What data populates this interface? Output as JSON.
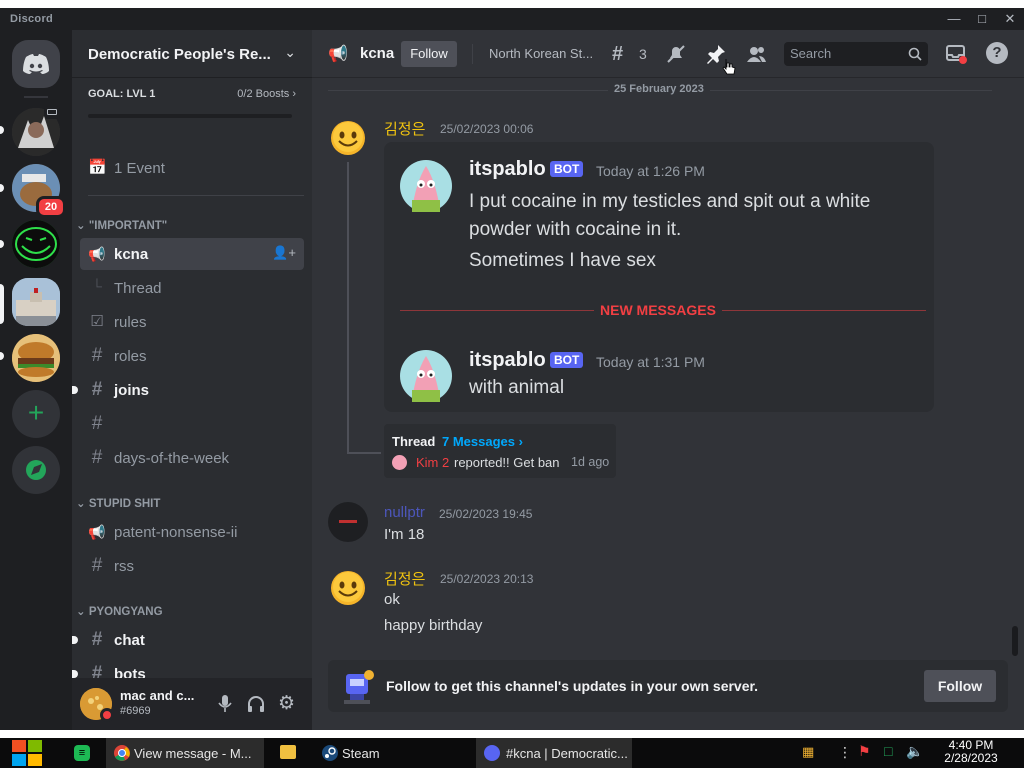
{
  "window": {
    "title": "Discord",
    "controls": [
      "minimize",
      "maximize",
      "close"
    ]
  },
  "servers": [
    {
      "name": "server-1",
      "color": "#3a3a3a",
      "unread": true,
      "badge": null
    },
    {
      "name": "server-2",
      "color": "#7a5a3a",
      "unread": true,
      "badge": "20"
    },
    {
      "name": "server-3",
      "color": "#1f8a2e",
      "unread": true,
      "badge": null
    },
    {
      "name": "server-4",
      "color": "#8aa0b8",
      "selected": true,
      "badge": null
    },
    {
      "name": "server-5",
      "color": "#c48a3c",
      "unread": true,
      "badge": null
    }
  ],
  "guild": {
    "name": "Democratic People's Re...",
    "goal_label": "GOAL: LVL 1",
    "boosts": "0/2 Boosts",
    "events": "1 Event"
  },
  "categories": [
    {
      "label": "\"IMPORTANT\""
    },
    {
      "label": "STUPID SHIT"
    },
    {
      "label": "PYONGYANG"
    }
  ],
  "channels": {
    "kcna": "kcna",
    "thread": "Thread",
    "rules": "rules",
    "roles": "roles",
    "joins": "joins",
    "blank": "",
    "days": "days-of-the-week",
    "patent": "patent-nonsense-ii",
    "rss": "rss",
    "chat": "chat",
    "bots": "bots"
  },
  "user": {
    "name": "mac and c...",
    "tag": "#6969"
  },
  "topbar": {
    "channel": "kcna",
    "follow": "Follow",
    "topic": "North Korean St...",
    "thread_count": "3",
    "search_placeholder": "Search"
  },
  "date_divider": "25 February 2023",
  "messages": [
    {
      "author": "김정은",
      "author_color": "#f0c30f",
      "timestamp": "25/02/2023 00:06"
    },
    {
      "author": "nullptr",
      "author_color": "#5865f2",
      "timestamp": "25/02/2023 19:45",
      "text": "I'm 18"
    },
    {
      "author": "김정은",
      "author_color": "#f0c30f",
      "timestamp": "25/02/2023 20:13",
      "lines": [
        "ok",
        "happy birthday"
      ]
    }
  ],
  "forwarded": {
    "author": "itspablo",
    "bot_tag": "BOT",
    "time1": "Today at 1:26 PM",
    "line1": "I put cocaine in my testicles and spit out a white",
    "line1b": "powder with cocaine in it.",
    "line2": "Sometimes I have sex",
    "new_messages": "NEW MESSAGES",
    "time2": "Today at 1:31 PM",
    "line3": "with animal"
  },
  "thread": {
    "label": "Thread",
    "count": "7 Messages ›",
    "author": "Kim 2",
    "preview": "reported!! Get ban",
    "ago": "1d ago"
  },
  "follow_banner": {
    "text": "Follow to get this channel's updates in your own server.",
    "button": "Follow"
  },
  "taskbar": {
    "items": [
      "View message - M...",
      "Steam",
      "#kcna | Democratic..."
    ],
    "time": "4:40 PM",
    "date": "2/28/2023"
  },
  "colors": {
    "accent": "#5865f2",
    "danger": "#f23f43",
    "link": "#00a8fc",
    "online_green": "#23a55a"
  }
}
